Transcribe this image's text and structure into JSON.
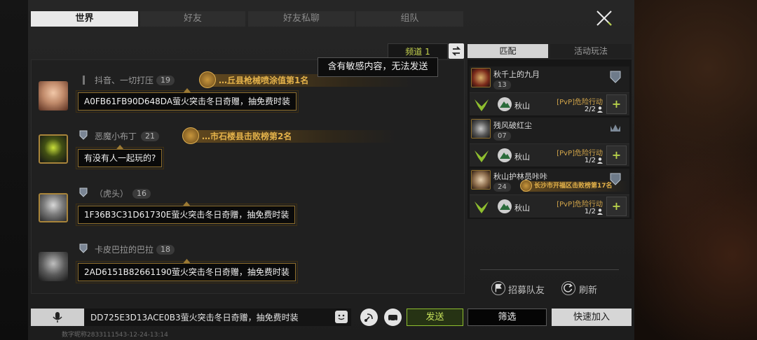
{
  "top_tabs": [
    "世界",
    "好友",
    "好友私聊",
    "组队"
  ],
  "channel": {
    "label": "频道 1"
  },
  "warning": "含有敏感内容，无法发送",
  "messages": [
    {
      "name": "抖音、一切打压",
      "level": "19",
      "title": "…丘县枪械喷涂值第1名",
      "text": "A0FB61FB90D648DA萤火突击冬日奇赠，抽免费时装"
    },
    {
      "name": "恶魔小布丁",
      "level": "21",
      "title": "…市石楼县击败榜第2名",
      "text": "有没有人一起玩的?"
    },
    {
      "name": "（虎头）",
      "level": "16",
      "title": "",
      "text": "1F36B3C31D61730E萤火突击冬日奇赠，抽免费时装"
    },
    {
      "name": "卡皮巴拉的巴拉",
      "level": "18",
      "title": "",
      "text": "2AD6151B82661190萤火突击冬日奇赠，抽免费时装"
    }
  ],
  "right_panel": {
    "tabs": [
      "匹配",
      "活动玩法"
    ],
    "teams": [
      {
        "name": "秋千上的九月",
        "level": "13",
        "title": "",
        "map": "秋山",
        "mode": "[PvP]危险行动",
        "count": "2/2"
      },
      {
        "name": "残风破红尘",
        "level": "07",
        "title": "",
        "map": "秋山",
        "mode": "[PvP]危险行动",
        "count": "1/2"
      },
      {
        "name": "秋山护林员咔咔",
        "level": "24",
        "title": "长沙市开福区击败榜第17名",
        "map": "秋山",
        "mode": "[PvP]危险行动",
        "count": "1/2"
      }
    ],
    "recruit_label": "招募队友",
    "refresh_label": "刷新"
  },
  "bottom": {
    "input_value": "DD725E3D13ACE0B3萤火突击冬日奇赠，抽免费时装",
    "send_label": "发送",
    "filter_label": "筛选",
    "quick_join_label": "快速加入",
    "watermark": "数字昵称2833111543-12-24-13:14"
  },
  "colors": {
    "accent_green": "#8fbf2f",
    "gold": "#e4b24a"
  }
}
